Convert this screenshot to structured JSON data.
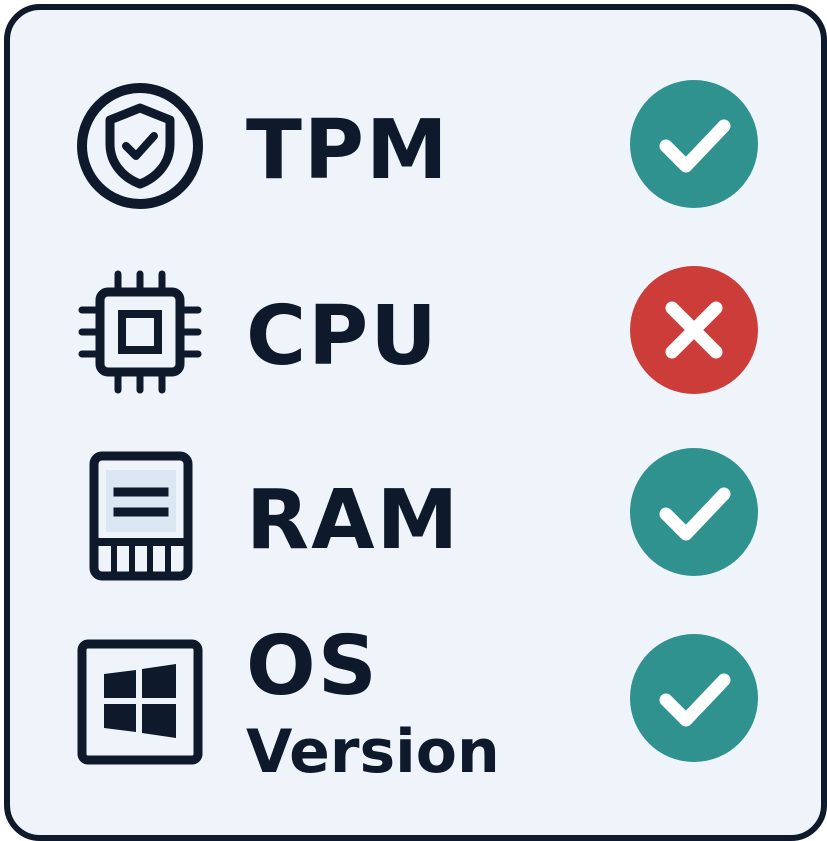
{
  "colors": {
    "ink": "#0e1a2b",
    "background": "#eef4fa",
    "pass": "#2f928e",
    "fail": "#cc3d39"
  },
  "requirements": [
    {
      "label": "TPM",
      "icon": "shield-check-icon",
      "status": "pass"
    },
    {
      "label": "CPU",
      "icon": "cpu-chip-icon",
      "status": "fail"
    },
    {
      "label": "RAM",
      "icon": "memory-module-icon",
      "status": "pass"
    },
    {
      "label": "OS",
      "sublabel": "Version",
      "icon": "windows-logo-icon",
      "status": "pass"
    }
  ]
}
